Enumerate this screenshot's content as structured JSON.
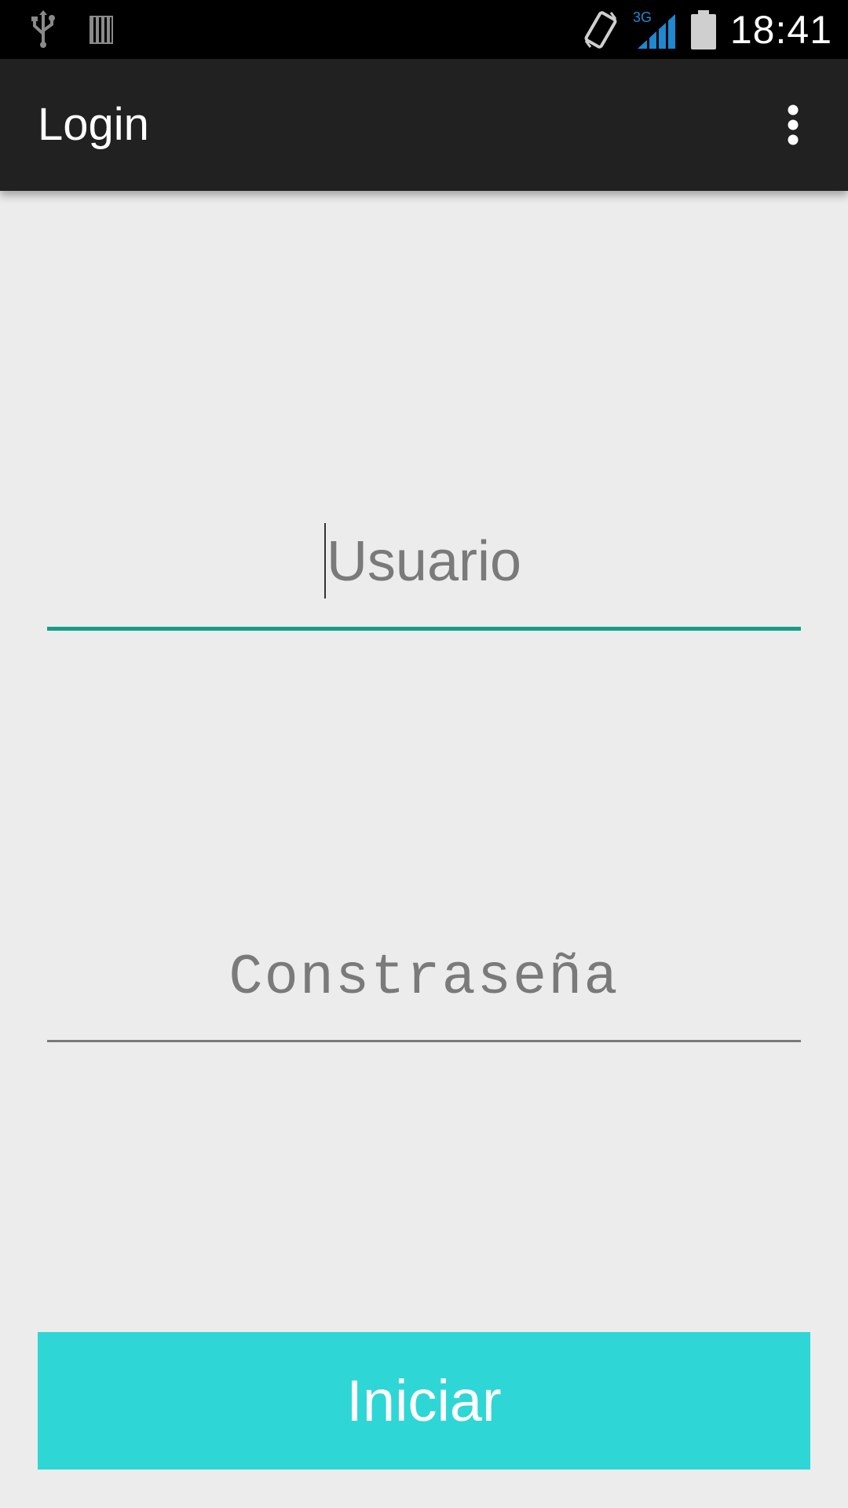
{
  "status_bar": {
    "time": "18:41",
    "network_type": "3G",
    "icons": [
      "usb-icon",
      "sd-card-icon",
      "vibrate-icon",
      "signal-3g-icon",
      "battery-icon"
    ]
  },
  "action_bar": {
    "title": "Login",
    "overflow_icon": "overflow-menu-icon"
  },
  "form": {
    "username": {
      "value": "",
      "placeholder": "Usuario"
    },
    "password": {
      "value": "",
      "placeholder": "Constraseña"
    },
    "submit_label": "Iniciar"
  },
  "colors": {
    "status_bar": "#000000",
    "action_bar": "#212121",
    "background": "#ececec",
    "accent_focus": "#149c8c",
    "button": "#2fd6d6",
    "signal_blue": "#1e88d0"
  }
}
